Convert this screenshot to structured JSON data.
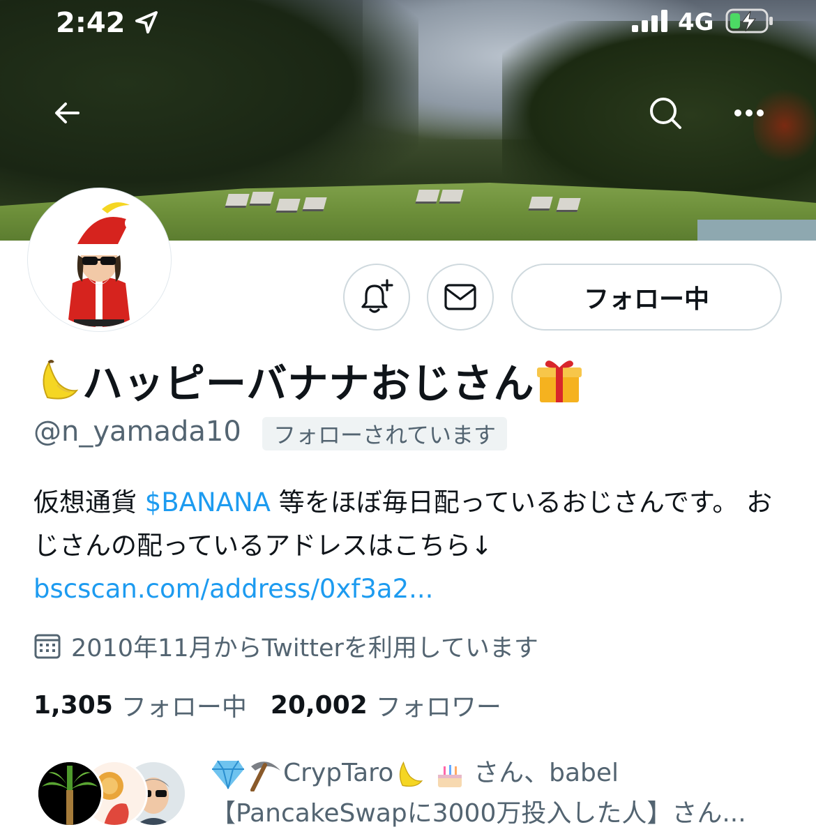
{
  "status_bar": {
    "time": "2:42",
    "network": "4G"
  },
  "header": {
    "back_icon": "arrow-left-icon",
    "search_icon": "search-icon",
    "more_icon": "more-horizontal-icon"
  },
  "actions": {
    "notify_icon": "bell-plus-icon",
    "message_icon": "mail-icon",
    "follow_label": "フォロー中"
  },
  "profile": {
    "display_name": "ハッピーバナナおじさん",
    "name_prefix_emoji": "banana-emoji",
    "name_suffix_emoji": "gift-emoji",
    "handle": "@n_yamada10",
    "follows_you": "フォローされています",
    "bio_part1": "仮想通貨 ",
    "bio_cashtag": "$BANANA",
    "bio_part2": " 等をほぼ毎日配っているおじさんです。 おじさんの配っているアドレスはこちら↓",
    "bio_link": "bscscan.com/address/0xf3a2...",
    "joined": "2010年11月からTwitterを利用しています",
    "following_count": "1,305",
    "following_label": "フォロー中",
    "followers_count": "20,002",
    "followers_label": "フォロワー"
  },
  "known_followers": {
    "line1_prefix": "CrypTaro",
    "line1_suffix": " さん、babel",
    "line2": "【PancakeSwapに3000万投入した人】さん..."
  },
  "colors": {
    "accent": "#1d9bf0",
    "secondary_text": "#536471",
    "primary_text": "#0f1419"
  }
}
